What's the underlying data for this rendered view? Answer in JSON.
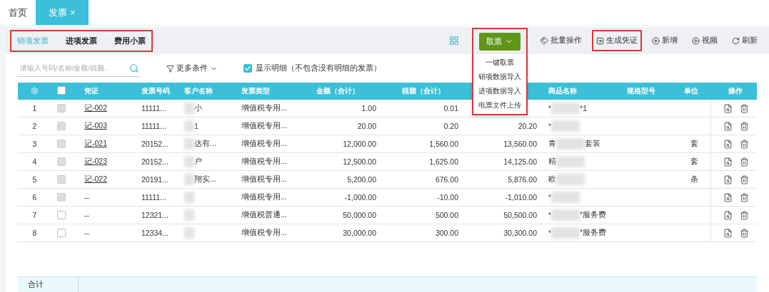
{
  "page_tabs": [
    {
      "label": "首页",
      "selected": false
    },
    {
      "label": "发票",
      "selected": true,
      "close": "×"
    }
  ],
  "invoice_tabs": {
    "highlighted": true,
    "items": [
      {
        "label": "销项发票",
        "selected": true
      },
      {
        "label": "进项发票",
        "selected": false
      },
      {
        "label": "费用小票",
        "selected": false
      }
    ]
  },
  "toolbar": {
    "fetch": {
      "label": "取票",
      "highlighted": true,
      "expanded": true,
      "menu": [
        "一键取票",
        "销项数据导入",
        "进项数据导入",
        "电票文件上传"
      ]
    },
    "actions": [
      {
        "kind": "batch",
        "label": "批量操作",
        "highlighted": false
      },
      {
        "kind": "voucher",
        "label": "生成凭证",
        "highlighted": true
      },
      {
        "kind": "add",
        "label": "新增",
        "highlighted": false
      },
      {
        "kind": "video",
        "label": "视频",
        "highlighted": false
      },
      {
        "kind": "refresh",
        "label": "刷新",
        "highlighted": false
      }
    ]
  },
  "filters": {
    "search_placeholder": "请输入号码/名称/金额/税额...",
    "more": "更多条件",
    "show_detail": {
      "label": "显示明细（不包含没有明细的发票）",
      "checked": true
    }
  },
  "table": {
    "columns": [
      "凭证",
      "发票号码",
      "客户名称",
      "发票类型",
      "金额（合计）",
      "税额（合计）",
      null,
      "商品名称",
      "规格型号",
      "单位",
      "操作"
    ],
    "header_checked": false,
    "rows": [
      {
        "index": "1",
        "checked": false,
        "disabled": true,
        "voucher": "记-002",
        "voucher_link": true,
        "number": "11111...",
        "customer": "小",
        "customer_redacted": true,
        "type": "增值税专用...",
        "amount": "1.00",
        "tax": "0.01",
        "product_start": "*",
        "product_end": "*1",
        "product_redacted": true
      },
      {
        "index": "2",
        "checked": false,
        "disabled": true,
        "voucher": "记-003",
        "voucher_link": true,
        "number": "11111...",
        "customer": "1",
        "customer_redacted": true,
        "type": "增值税专用...",
        "amount": "20.00",
        "tax": "0.20",
        "total": "20.20",
        "product_start": "*",
        "product_redacted": true
      },
      {
        "index": "3",
        "checked": false,
        "disabled": true,
        "voucher": "记-021",
        "voucher_link": true,
        "number": "20152...",
        "customer": "达有...",
        "customer_redacted": true,
        "type": "增值税专用...",
        "amount": "12,000.00",
        "tax": "1,560.00",
        "total": "13,560.00",
        "product_start": "青",
        "product_end": "套装",
        "product_redacted": true,
        "unit": "套"
      },
      {
        "index": "4",
        "checked": false,
        "disabled": true,
        "voucher": "记-023",
        "voucher_link": true,
        "number": "20152...",
        "customer": "户",
        "customer_redacted": true,
        "type": "增值税专用...",
        "amount": "12,500.00",
        "tax": "1,625.00",
        "total": "14,125.00",
        "product_start": "精",
        "product_redacted": true,
        "unit": "套"
      },
      {
        "index": "5",
        "checked": false,
        "disabled": true,
        "voucher": "记-022",
        "voucher_link": true,
        "number": "20191...",
        "customer": "翔实...",
        "customer_redacted": true,
        "type": "增值税专用...",
        "amount": "5,200.00",
        "tax": "676.00",
        "total": "5,876.00",
        "product_start": "欧",
        "product_redacted": true,
        "unit": "条"
      },
      {
        "index": "6",
        "checked": false,
        "disabled": true,
        "voucher": "--",
        "voucher_link": false,
        "number": "11111...",
        "customer_redacted": true,
        "type": "增值税专用...",
        "amount": "-1,000.00",
        "tax": "-10.00",
        "total": "-1,010.00",
        "product_start": "*",
        "product_redacted": true
      },
      {
        "index": "7",
        "checked": false,
        "disabled": false,
        "voucher": "--",
        "voucher_link": false,
        "number": "12321...",
        "customer_redacted": true,
        "type": "增值税普通...",
        "amount": "50,000.00",
        "tax": "500.00",
        "total": "50,500.00",
        "product_start": "*",
        "product_end": "*服务费",
        "product_redacted": true
      },
      {
        "index": "8",
        "checked": false,
        "disabled": false,
        "voucher": "--",
        "voucher_link": false,
        "number": "12334...",
        "customer_redacted": true,
        "type": "增值税专用...",
        "amount": "30,000.00",
        "tax": "300.00",
        "total": "30,300.00",
        "product_start": "*",
        "product_end": "*服务费",
        "product_redacted": true
      }
    ],
    "footer_label": "合计"
  }
}
